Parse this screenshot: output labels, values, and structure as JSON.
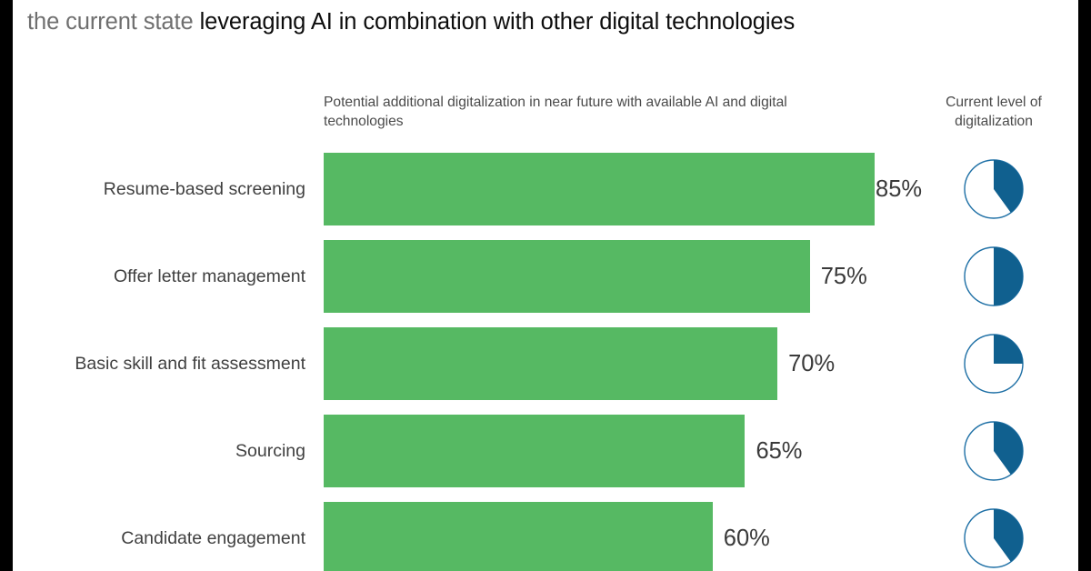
{
  "title": {
    "muted_part": "the current state",
    "strong_part": "leveraging AI in combination with other digital technologies"
  },
  "headers": {
    "left": "Potential additional digitalization in near future with available AI and digital technologies",
    "right_line1": "Current level of",
    "right_line2": "digitalization"
  },
  "colors": {
    "bar_green": "#56b963",
    "pie_blue": "#10608f",
    "pie_outline": "#1d6fa5",
    "label_gray": "#3f3f3f",
    "title_muted": "#6f6f6f",
    "edge_black": "#000000"
  },
  "chart_data": {
    "type": "bar",
    "title": "the current state leveraging AI in combination with other digital technologies",
    "xlabel": "",
    "ylabel": "",
    "xlim": [
      0,
      100
    ],
    "grid": false,
    "legend_position": "none",
    "categories": [
      "Resume-based screening",
      "Offer letter management",
      "Basic skill and fit assessment",
      "Sourcing",
      "Candidate engagement"
    ],
    "series": [
      {
        "name": "Potential additional digitalization in near future with available AI and digital technologies",
        "values": [
          85,
          75,
          70,
          65,
          60
        ],
        "value_labels": [
          "85%",
          "75%",
          "70%",
          "65%",
          "60%"
        ],
        "color": "#56b963"
      },
      {
        "name": "Current level of digitalization",
        "type": "pie",
        "values": [
          40,
          50,
          25,
          40,
          40
        ],
        "color": "#10608f"
      }
    ]
  },
  "rows": [
    {
      "label": "Resume-based screening",
      "value": 85,
      "value_label": "85%",
      "pie_pct": 40
    },
    {
      "label": "Offer letter management",
      "value": 75,
      "value_label": "75%",
      "pie_pct": 50
    },
    {
      "label": "Basic skill and fit assessment",
      "value": 70,
      "value_label": "70%",
      "pie_pct": 25
    },
    {
      "label": "Sourcing",
      "value": 65,
      "value_label": "65%",
      "pie_pct": 40
    },
    {
      "label": "Candidate engagement",
      "value": 60,
      "value_label": "60%",
      "pie_pct": 40
    }
  ]
}
